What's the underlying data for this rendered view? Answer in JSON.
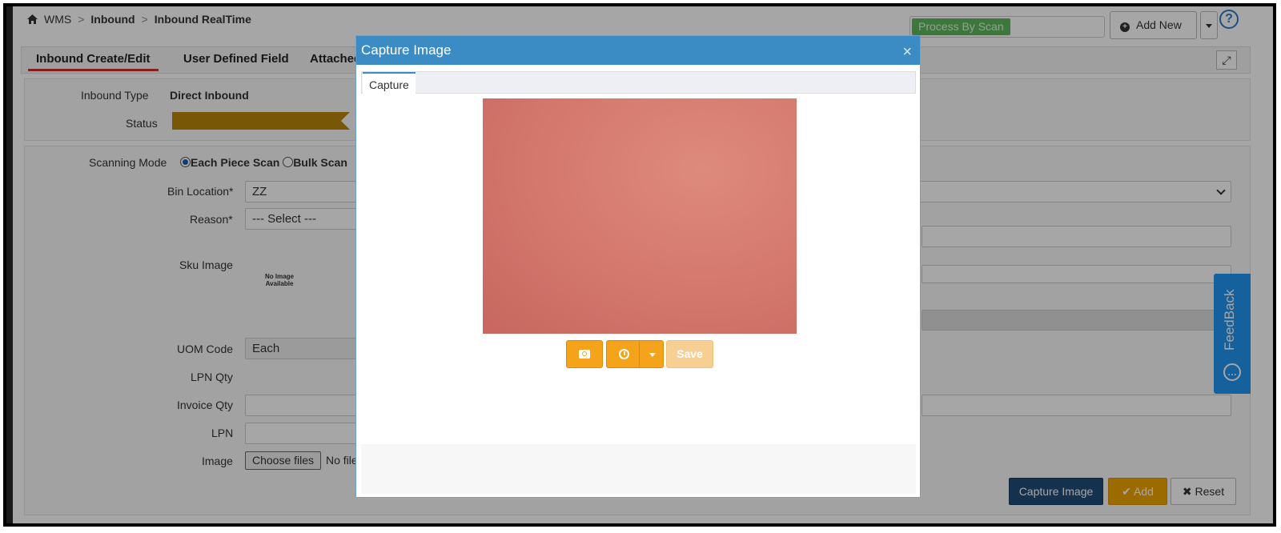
{
  "breadcrumb": {
    "home": "WMS",
    "section": "Inbound",
    "page": "Inbound RealTime"
  },
  "header": {
    "process_by_scan": "Process By Scan",
    "add_new": "Add New",
    "help": "?"
  },
  "tabs": [
    "Inbound Create/Edit",
    "User Defined Field",
    "Attached"
  ],
  "info": {
    "inbound_type_label": "Inbound Type",
    "inbound_type_value": "Direct Inbound",
    "status_label": "Status"
  },
  "form": {
    "scanning_mode_label": "Scanning Mode",
    "scan_each": "Each Piece Scan",
    "scan_bulk": "Bulk Scan",
    "bin_location_label": "Bin Location*",
    "bin_location_value": "ZZ",
    "reason_label": "Reason*",
    "reason_value": "--- Select ---",
    "sku_image_label": "Sku Image",
    "no_image_line1": "No Image",
    "no_image_line2": "Available",
    "uom_label": "UOM Code",
    "uom_value": "Each",
    "lpn_qty_label": "LPN Qty",
    "invoice_qty_label": "Invoice Qty",
    "lpn_label": "LPN",
    "image_label": "Image",
    "choose_files": "Choose files",
    "no_file": "No file"
  },
  "actions": {
    "capture_image": "Capture Image",
    "add": "Add",
    "reset": "Reset"
  },
  "feedback": "FeedBack",
  "modal": {
    "title": "Capture Image",
    "close": "×",
    "tab": "Capture",
    "save": "Save"
  },
  "colors": {
    "primary": "#3b8cc4",
    "accent": "#f5a31b",
    "status": "#b8860b",
    "feedback": "#2196f3"
  }
}
